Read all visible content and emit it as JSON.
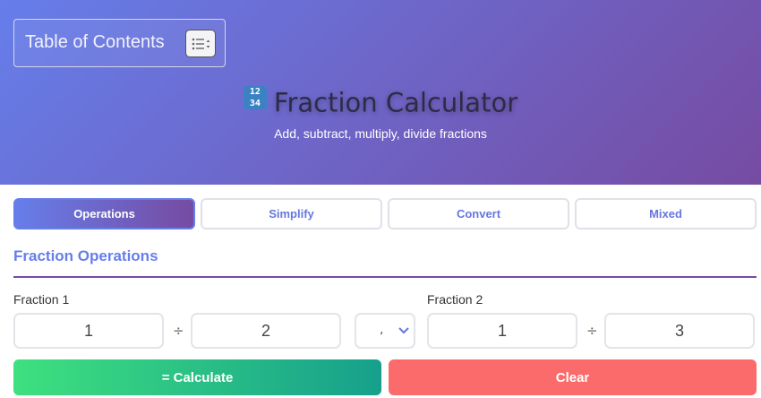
{
  "toc": {
    "title": "Table of Contents",
    "toggle_icon": "list-icon"
  },
  "header": {
    "icon": "numbers-icon",
    "icon_digits": [
      "1",
      "2",
      "3",
      "4"
    ],
    "title": "Fraction Calculator",
    "subtitle": "Add, subtract, multiply, divide fractions"
  },
  "tabs": [
    {
      "label": "Operations",
      "active": true
    },
    {
      "label": "Simplify",
      "active": false
    },
    {
      "label": "Convert",
      "active": false
    },
    {
      "label": "Mixed",
      "active": false
    }
  ],
  "section": {
    "title": "Fraction Operations"
  },
  "fraction1": {
    "label": "Fraction 1",
    "numerator": "1",
    "separator": "÷",
    "denominator": "2"
  },
  "operator": {
    "selected": ","
  },
  "fraction2": {
    "label": "Fraction 2",
    "numerator": "1",
    "separator": "÷",
    "denominator": "3"
  },
  "buttons": {
    "calculate": "= Calculate",
    "clear": "Clear"
  },
  "colors": {
    "gradient_start": "#667eea",
    "gradient_end": "#764ba2",
    "calculate_start": "#3ee07f",
    "calculate_end": "#16a08c",
    "clear": "#fc6b6b"
  }
}
